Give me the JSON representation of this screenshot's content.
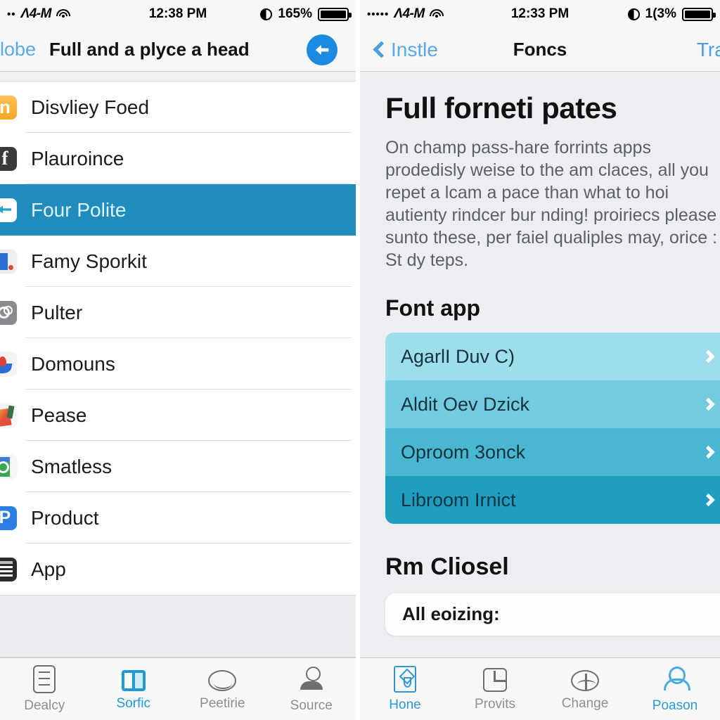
{
  "left": {
    "status": {
      "dots": "••",
      "carrier": "Λ4‑M",
      "wifi_icon": "wifi-icon",
      "time": "12:38 PM",
      "contrast_icon": "half-moon-icon",
      "battery_percent": "165%",
      "battery_icon": "battery-icon"
    },
    "nav": {
      "left_label": "lobe",
      "title": "Full and a plyce a head",
      "action_icon": "back-arrow-circle-icon"
    },
    "list": [
      {
        "label": "Disvliey Foed",
        "icon": "orange-app-icon",
        "icon_class": "ic-orange",
        "selected": false
      },
      {
        "label": "Plauroince",
        "icon": "facebook-app-icon",
        "icon_class": "ic-dark",
        "selected": false
      },
      {
        "label": "Four Polite",
        "icon": "messenger-app-icon",
        "icon_class": "ic-white",
        "selected": true
      },
      {
        "label": "Famy Sporkit",
        "icon": "blue-chart-app-icon",
        "icon_class": "ic-blue1",
        "selected": false
      },
      {
        "label": "Pulter",
        "icon": "grey-contacts-icon",
        "icon_class": "ic-grey",
        "selected": false
      },
      {
        "label": "Domouns",
        "icon": "maps-app-icon",
        "icon_class": "ic-maps",
        "selected": false
      },
      {
        "label": "Pease",
        "icon": "photos-app-icon",
        "icon_class": "ic-photos",
        "selected": false
      },
      {
        "label": "Smatless",
        "icon": "green-maps-app-icon",
        "icon_class": "ic-green",
        "selected": false
      },
      {
        "label": "Product",
        "icon": "blue-p-app-icon",
        "icon_class": "ic-pblue",
        "selected": false
      },
      {
        "label": "App",
        "icon": "news-app-icon",
        "icon_class": "ic-news",
        "selected": false
      }
    ],
    "tabs": [
      {
        "label": "Dealcy",
        "icon": "document-icon",
        "icon_class": "ti-doc",
        "active": false
      },
      {
        "label": "Sorfic",
        "icon": "panels-icon",
        "icon_class": "ti-sq",
        "active": true
      },
      {
        "label": "Peetirie",
        "icon": "chat-icon",
        "icon_class": "ti-chat",
        "active": false
      },
      {
        "label": "Source",
        "icon": "person-icon",
        "icon_class": "ti-user",
        "active": false
      }
    ]
  },
  "right": {
    "status": {
      "dots": "•••••",
      "carrier": "Λ4‑M",
      "wifi_icon": "wifi-icon",
      "time": "12:33 PM",
      "contrast_icon": "half-moon-icon",
      "battery_percent": "1(3%",
      "battery_icon": "battery-icon"
    },
    "nav": {
      "back_label": "Instle",
      "back_icon": "chevron-left-icon",
      "title": "Foncs",
      "right_label": "Trai"
    },
    "heading": "Full forneti pates",
    "paragraph": "On champ pass-hare forrints apps prodedisly weise to the am claces, all you repet a lcam a pace than what to hoi autienty rindcer bur nding! proiriecs please sunto these, per faiel qualiples may, orice : St dy teps.",
    "section_title": "Font app",
    "color_rows": [
      {
        "label": "AgarlI Duv C)",
        "color": "#9eddea",
        "chevron": "chevron-right-icon"
      },
      {
        "label": "Aldit Oev Dzick",
        "color": "#74cbdf",
        "chevron": "chevron-right-icon"
      },
      {
        "label": "Oproom 3onck",
        "color": "#49b6d2",
        "chevron": "chevron-right-icon"
      },
      {
        "label": "Libroom Irnict",
        "color": "#1f9ec2",
        "chevron": "chevron-right-icon"
      }
    ],
    "section_title_2": "Rm Cliosel",
    "bottom_card_text": "All eoizing:",
    "tabs": [
      {
        "label": "Hone",
        "icon": "flask-icon",
        "icon_class": "ti-flask",
        "active": true
      },
      {
        "label": "Provits",
        "icon": "grid-icon",
        "icon_class": "ti-grid",
        "active": false
      },
      {
        "label": "Change",
        "icon": "change-icon",
        "icon_class": "ti-chg",
        "active": false
      },
      {
        "label": "Poason",
        "icon": "profile-icon",
        "icon_class": "ti-person",
        "active": true
      }
    ]
  }
}
